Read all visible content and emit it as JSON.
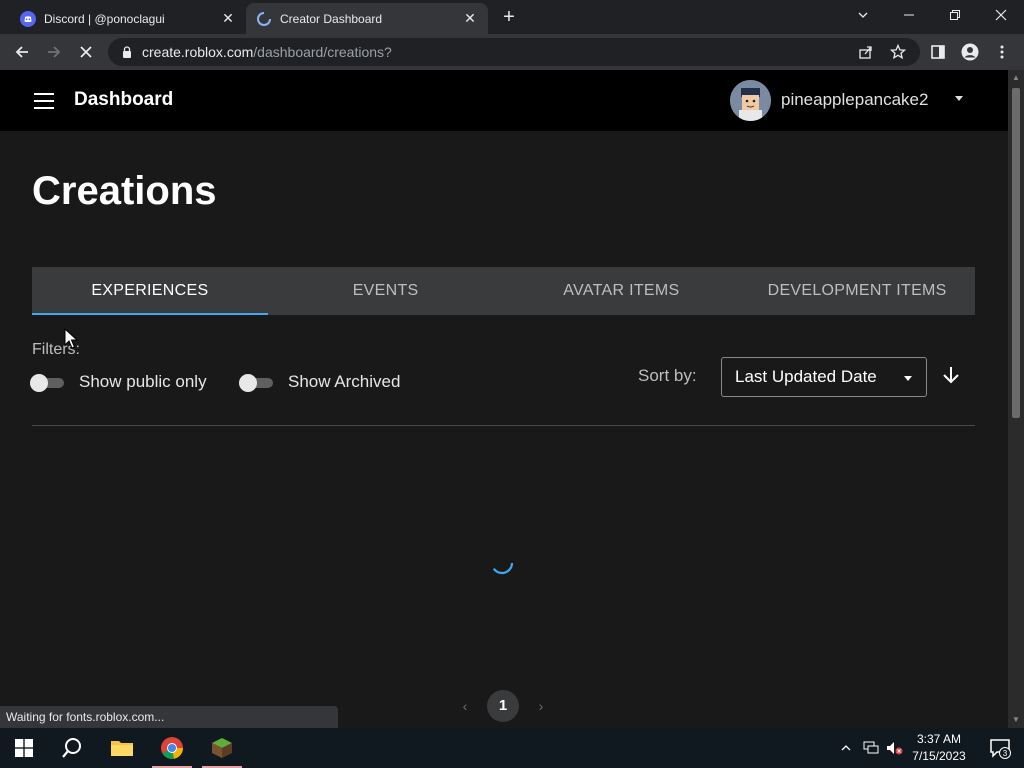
{
  "browser": {
    "tabs": [
      {
        "title": "Discord | @ponoclagui",
        "icon": "discord-icon"
      },
      {
        "title": "Creator Dashboard",
        "icon": "loading-spinner-icon"
      }
    ],
    "url_host": "create.roblox.com",
    "url_path": "/dashboard/creations?",
    "status_text": "Waiting for fonts.roblox.com..."
  },
  "header": {
    "title": "Dashboard",
    "username": "pineapplepancake2"
  },
  "main": {
    "heading": "Creations",
    "tabs": [
      {
        "label": "EXPERIENCES",
        "selected": true
      },
      {
        "label": "EVENTS",
        "selected": false
      },
      {
        "label": "AVATAR ITEMS",
        "selected": false
      },
      {
        "label": "DEVELOPMENT ITEMS",
        "selected": false
      }
    ],
    "filters_label": "Filters:",
    "toggles": [
      {
        "label": "Show public only",
        "on": false
      },
      {
        "label": "Show Archived",
        "on": false
      }
    ],
    "sort_label": "Sort by:",
    "sort_value": "Last Updated Date",
    "pagination": {
      "current": "1"
    }
  },
  "taskbar": {
    "time": "3:37 AM",
    "date": "7/15/2023",
    "notification_count": "3"
  },
  "colors": {
    "accent": "#3fa8f4",
    "page_bg": "#191919",
    "appbar_bg": "#000000",
    "tabs_bg": "#393b3d"
  }
}
